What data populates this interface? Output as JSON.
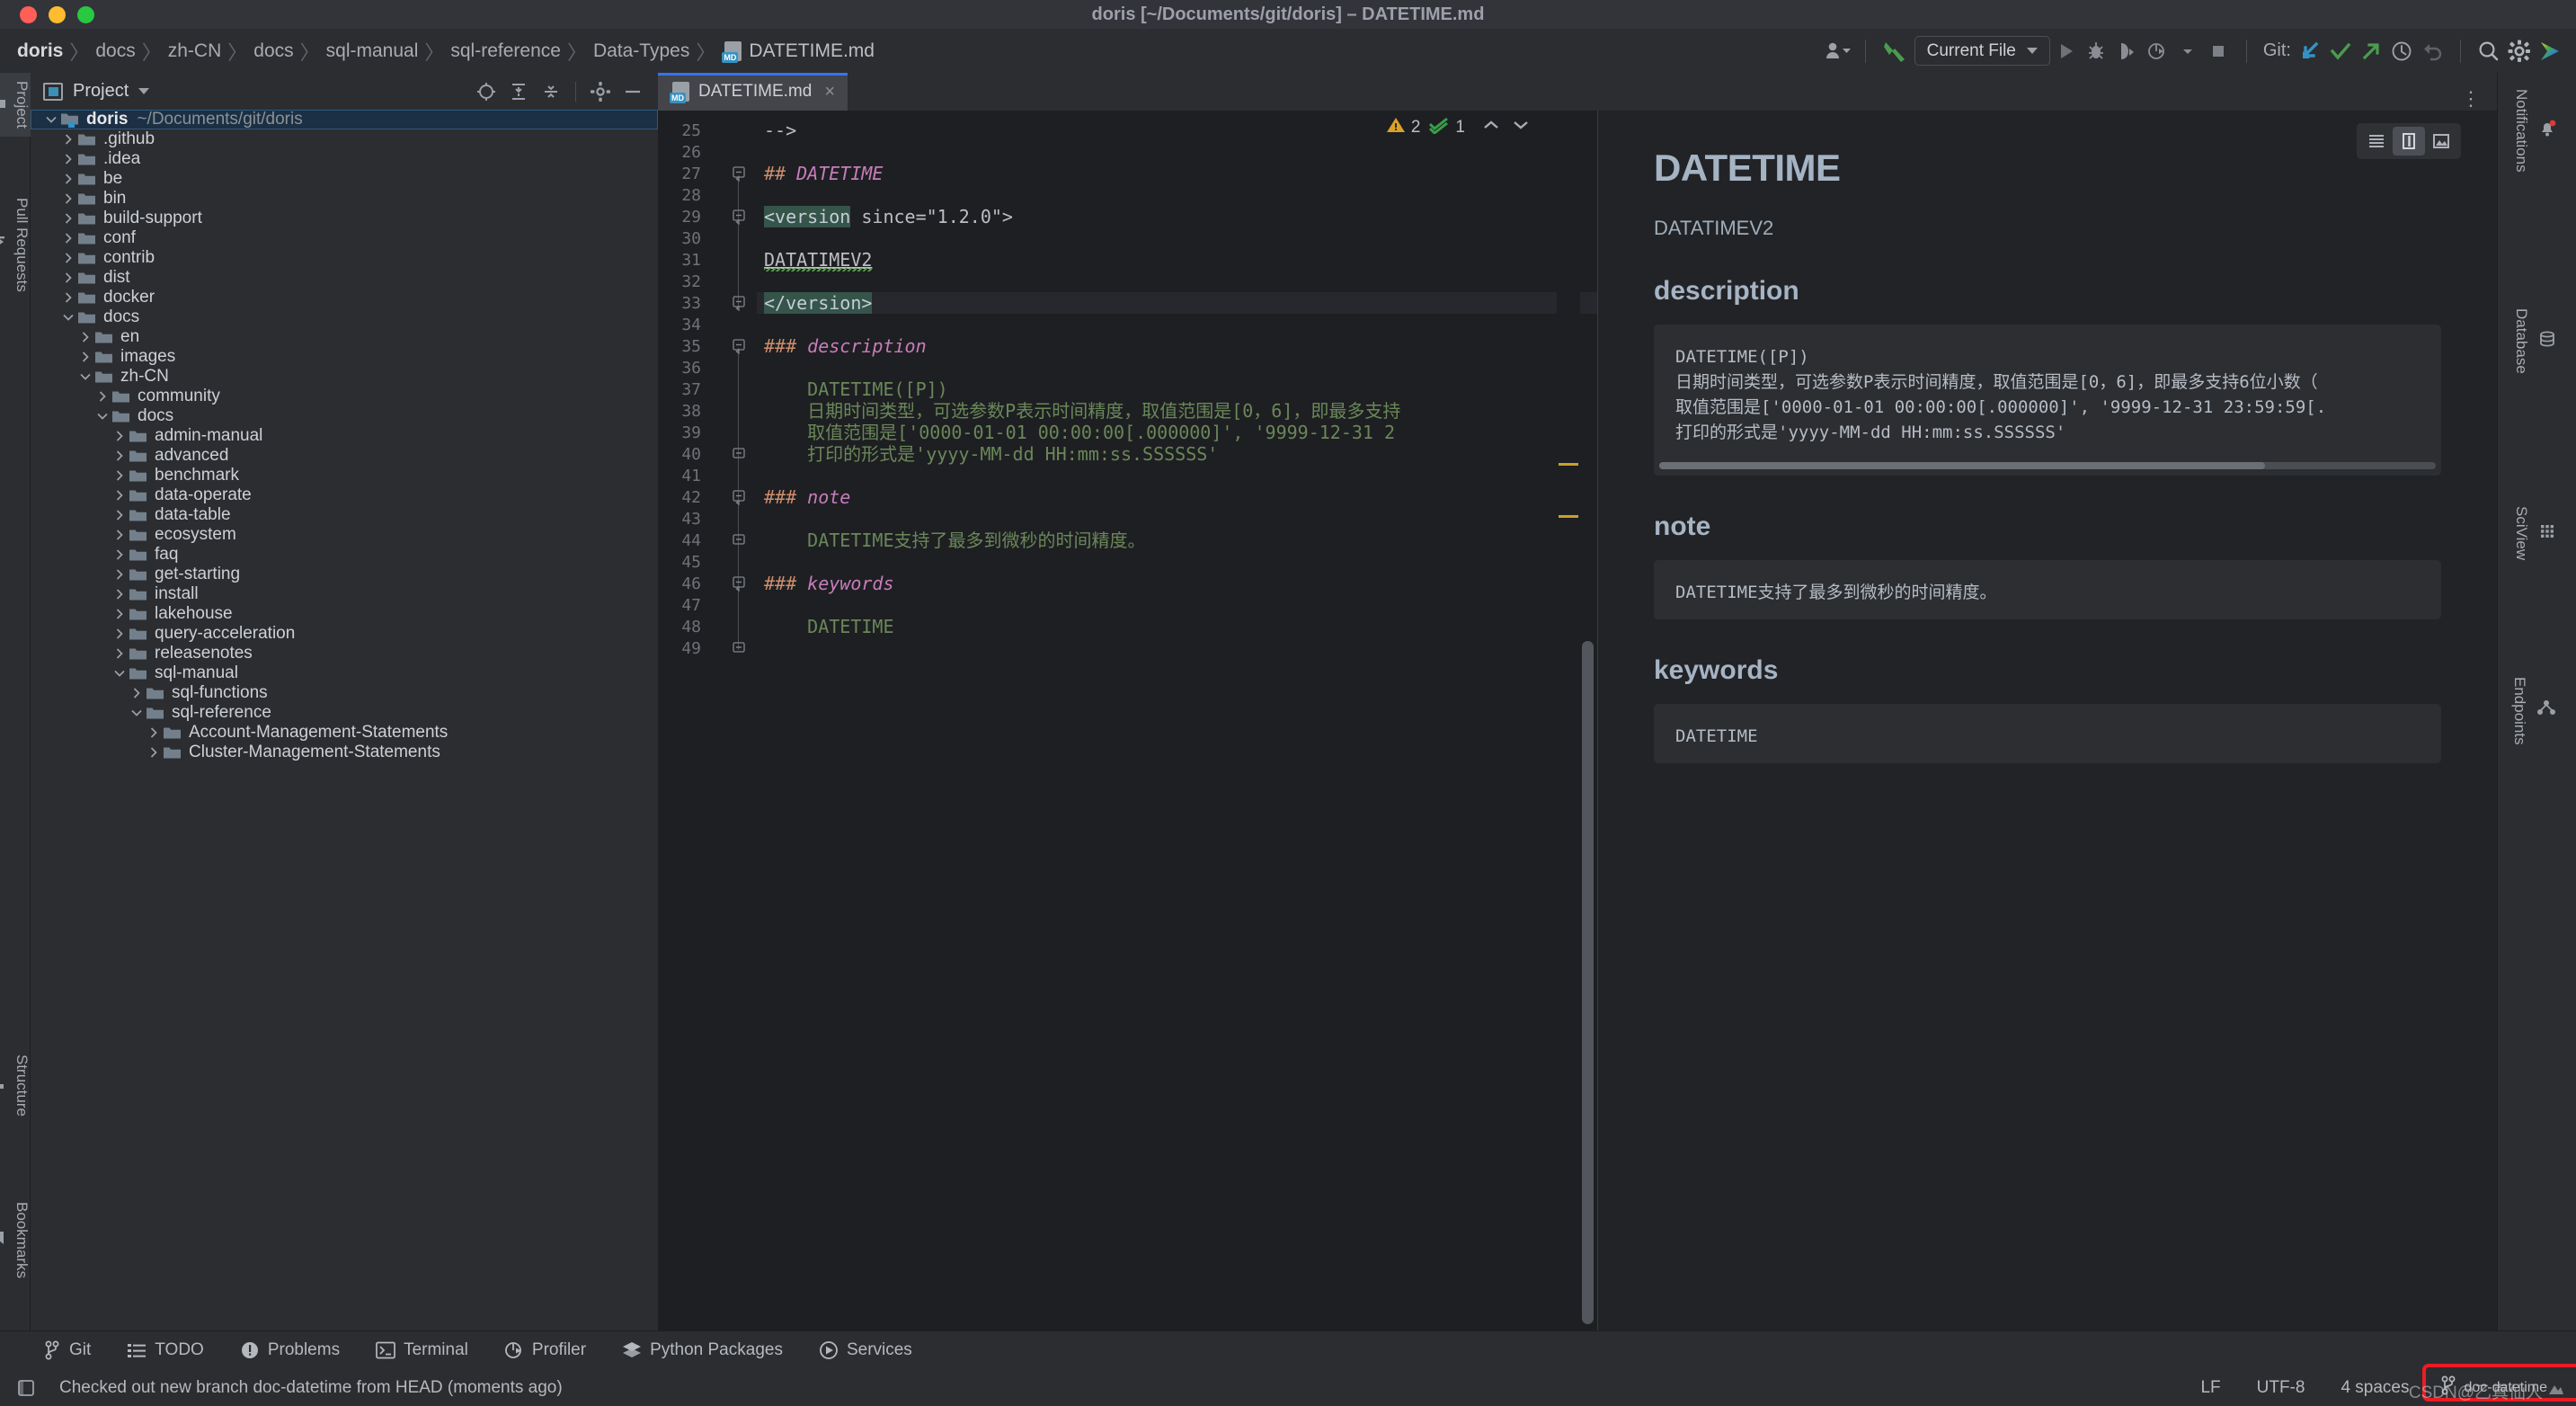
{
  "window": {
    "title": "doris [~/Documents/git/doris] – DATETIME.md",
    "traffic_lights": [
      "close",
      "minimize",
      "zoom"
    ]
  },
  "breadcrumb": {
    "items": [
      "doris",
      "docs",
      "zh-CN",
      "docs",
      "sql-manual",
      "sql-reference",
      "Data-Types"
    ],
    "file": "DATETIME.md",
    "file_icon": "markdown-file-icon"
  },
  "toolbar": {
    "run_config": "Current File",
    "git_label": "Git:",
    "icons": [
      "user-avatar-dropdown-icon",
      "build-hammer-icon",
      "run-icon",
      "debug-icon",
      "run-with-coverage-icon",
      "profile-icon",
      "stop-icon",
      "git-update-icon",
      "git-commit-icon",
      "git-push-icon",
      "history-icon",
      "rollback-icon",
      "search-everywhere-icon",
      "settings-gear-icon",
      "ai-assistant-icon"
    ]
  },
  "left_stripe": [
    {
      "label": "Project",
      "icon": "project-folder-icon",
      "active": true
    },
    {
      "label": "Pull Requests",
      "icon": "pull-request-icon",
      "active": false
    },
    {
      "label": "Structure",
      "icon": "structure-icon",
      "active": false
    },
    {
      "label": "Bookmarks",
      "icon": "bookmarks-icon",
      "active": false
    }
  ],
  "right_stripe": [
    {
      "label": "Notifications",
      "icon": "bell-icon",
      "badge": true
    },
    {
      "label": "Database",
      "icon": "database-icon",
      "badge": false
    },
    {
      "label": "SciView",
      "icon": "sciview-grid-icon",
      "badge": false
    },
    {
      "label": "Endpoints",
      "icon": "endpoints-icon",
      "badge": false
    }
  ],
  "project_panel": {
    "title": "Project",
    "actions": [
      "locate-icon",
      "expand-all-icon",
      "collapse-all-icon",
      "settings-gear-icon",
      "hide-icon"
    ],
    "tree": [
      {
        "depth": 0,
        "label": "doris",
        "sub": "~/Documents/git/doris",
        "state": "open",
        "selected": true
      },
      {
        "depth": 1,
        "label": ".github",
        "state": "closed"
      },
      {
        "depth": 1,
        "label": ".idea",
        "state": "closed"
      },
      {
        "depth": 1,
        "label": "be",
        "state": "closed"
      },
      {
        "depth": 1,
        "label": "bin",
        "state": "closed"
      },
      {
        "depth": 1,
        "label": "build-support",
        "state": "closed"
      },
      {
        "depth": 1,
        "label": "conf",
        "state": "closed"
      },
      {
        "depth": 1,
        "label": "contrib",
        "state": "closed"
      },
      {
        "depth": 1,
        "label": "dist",
        "state": "closed"
      },
      {
        "depth": 1,
        "label": "docker",
        "state": "closed"
      },
      {
        "depth": 1,
        "label": "docs",
        "state": "open"
      },
      {
        "depth": 2,
        "label": "en",
        "state": "closed"
      },
      {
        "depth": 2,
        "label": "images",
        "state": "closed"
      },
      {
        "depth": 2,
        "label": "zh-CN",
        "state": "open"
      },
      {
        "depth": 3,
        "label": "community",
        "state": "closed"
      },
      {
        "depth": 3,
        "label": "docs",
        "state": "open"
      },
      {
        "depth": 4,
        "label": "admin-manual",
        "state": "closed"
      },
      {
        "depth": 4,
        "label": "advanced",
        "state": "closed"
      },
      {
        "depth": 4,
        "label": "benchmark",
        "state": "closed"
      },
      {
        "depth": 4,
        "label": "data-operate",
        "state": "closed"
      },
      {
        "depth": 4,
        "label": "data-table",
        "state": "closed"
      },
      {
        "depth": 4,
        "label": "ecosystem",
        "state": "closed"
      },
      {
        "depth": 4,
        "label": "faq",
        "state": "closed"
      },
      {
        "depth": 4,
        "label": "get-starting",
        "state": "closed"
      },
      {
        "depth": 4,
        "label": "install",
        "state": "closed"
      },
      {
        "depth": 4,
        "label": "lakehouse",
        "state": "closed"
      },
      {
        "depth": 4,
        "label": "query-acceleration",
        "state": "closed"
      },
      {
        "depth": 4,
        "label": "releasenotes",
        "state": "closed"
      },
      {
        "depth": 4,
        "label": "sql-manual",
        "state": "open"
      },
      {
        "depth": 5,
        "label": "sql-functions",
        "state": "closed"
      },
      {
        "depth": 5,
        "label": "sql-reference",
        "state": "open"
      },
      {
        "depth": 6,
        "label": "Account-Management-Statements",
        "state": "closed"
      },
      {
        "depth": 6,
        "label": "Cluster-Management-Statements",
        "state": "closed"
      }
    ]
  },
  "editor": {
    "tab": {
      "label": "DATETIME.md",
      "icon": "markdown-file-icon",
      "close": "×"
    },
    "tab_overflow_icon": "more-options-icon",
    "inspections": {
      "warning_count": "2",
      "ok_count": "1",
      "warning_icon": "warning-triangle-icon",
      "ok_icon": "inspection-ok-icon",
      "prev_icon": "chevron-up-icon",
      "next_icon": "chevron-down-icon"
    },
    "first_line": 25,
    "lines": [
      {
        "n": 25,
        "segs": [
          {
            "t": "-->",
            "c": "plain"
          }
        ]
      },
      {
        "n": 26,
        "segs": []
      },
      {
        "n": 27,
        "fold": "minus",
        "segs": [
          {
            "t": "## ",
            "c": "hash"
          },
          {
            "t": "DATETIME",
            "c": "head"
          }
        ]
      },
      {
        "n": 28,
        "segs": []
      },
      {
        "n": 29,
        "fold": "minus",
        "segs": [
          {
            "t": "<version",
            "c": "taghl"
          },
          {
            "t": " since=\"1.2.0\">",
            "c": "plain"
          }
        ]
      },
      {
        "n": 30,
        "segs": []
      },
      {
        "n": 31,
        "segs": [
          {
            "t": "DATATIMEV2",
            "c": "underline"
          }
        ]
      },
      {
        "n": 32,
        "segs": []
      },
      {
        "n": 33,
        "fold": "minus",
        "highlight": true,
        "segs": [
          {
            "t": "</version>",
            "c": "taghl"
          }
        ]
      },
      {
        "n": 34,
        "segs": []
      },
      {
        "n": 35,
        "fold": "minus",
        "segs": [
          {
            "t": "### ",
            "c": "hash"
          },
          {
            "t": "description",
            "c": "head"
          }
        ]
      },
      {
        "n": 36,
        "segs": []
      },
      {
        "n": 37,
        "segs": [
          {
            "t": "    DATETIME([P])",
            "c": "text"
          }
        ]
      },
      {
        "n": 38,
        "segs": [
          {
            "t": "    日期时间类型，可选参数P表示时间精度，取值范围是[0，6]，即最多支持",
            "c": "text"
          }
        ]
      },
      {
        "n": 39,
        "segs": [
          {
            "t": "    取值范围是['0000-01-01 00:00:00[.000000]', '9999-12-31 2",
            "c": "text"
          }
        ]
      },
      {
        "n": 40,
        "fold": "end",
        "segs": [
          {
            "t": "    打印的形式是'yyyy-MM-dd HH:mm:ss.SSSSSS'",
            "c": "text"
          }
        ]
      },
      {
        "n": 41,
        "segs": []
      },
      {
        "n": 42,
        "fold": "minus",
        "segs": [
          {
            "t": "### ",
            "c": "hash"
          },
          {
            "t": "note",
            "c": "head"
          }
        ]
      },
      {
        "n": 43,
        "segs": []
      },
      {
        "n": 44,
        "fold": "end",
        "segs": [
          {
            "t": "    DATETIME支持了最多到微秒的时间精度。",
            "c": "text"
          }
        ]
      },
      {
        "n": 45,
        "segs": []
      },
      {
        "n": 46,
        "fold": "minus",
        "segs": [
          {
            "t": "### ",
            "c": "hash"
          },
          {
            "t": "keywords",
            "c": "head"
          }
        ]
      },
      {
        "n": 47,
        "segs": []
      },
      {
        "n": 48,
        "segs": [
          {
            "t": "    DATETIME",
            "c": "text"
          }
        ]
      },
      {
        "n": 49,
        "fold": "end",
        "segs": []
      }
    ]
  },
  "preview": {
    "view_modes": [
      {
        "icon": "editor-only-icon",
        "active": false
      },
      {
        "icon": "split-view-icon",
        "active": true
      },
      {
        "icon": "preview-only-icon",
        "active": false
      }
    ],
    "h1": "DATETIME",
    "subtitle": "DATATIMEV2",
    "sections": [
      {
        "heading": "description",
        "code": "DATETIME([P])\n日期时间类型，可选参数P表示时间精度，取值范围是[0，6]，即最多支持6位小数（\n取值范围是['0000-01-01 00:00:00[.000000]', '9999-12-31 23:59:59[.\n打印的形式是'yyyy-MM-dd HH:mm:ss.SSSSSS'",
        "scrollbar": true
      },
      {
        "heading": "note",
        "code": "DATETIME支持了最多到微秒的时间精度。",
        "scrollbar": false
      },
      {
        "heading": "keywords",
        "code": "DATETIME",
        "scrollbar": false
      }
    ]
  },
  "bottom_bar": [
    {
      "label": "Git",
      "icon": "git-branch-icon"
    },
    {
      "label": "TODO",
      "icon": "todo-list-icon"
    },
    {
      "label": "Problems",
      "icon": "problems-icon"
    },
    {
      "label": "Terminal",
      "icon": "terminal-icon"
    },
    {
      "label": "Profiler",
      "icon": "profiler-icon"
    },
    {
      "label": "Python Packages",
      "icon": "python-packages-icon"
    },
    {
      "label": "Services",
      "icon": "services-icon"
    }
  ],
  "status_bar": {
    "left_icon": "toggle-toolwindows-icon",
    "message": "Checked out new branch doc-datetime from HEAD (moments ago)",
    "line_separator": "LF",
    "encoding": "UTF-8",
    "indent": "4 spaces",
    "branch": "doc-datetime",
    "branch_icon": "git-branch-icon",
    "highlight_color": "#ee1b24",
    "watermark": "CSDN@乙真仙人"
  }
}
